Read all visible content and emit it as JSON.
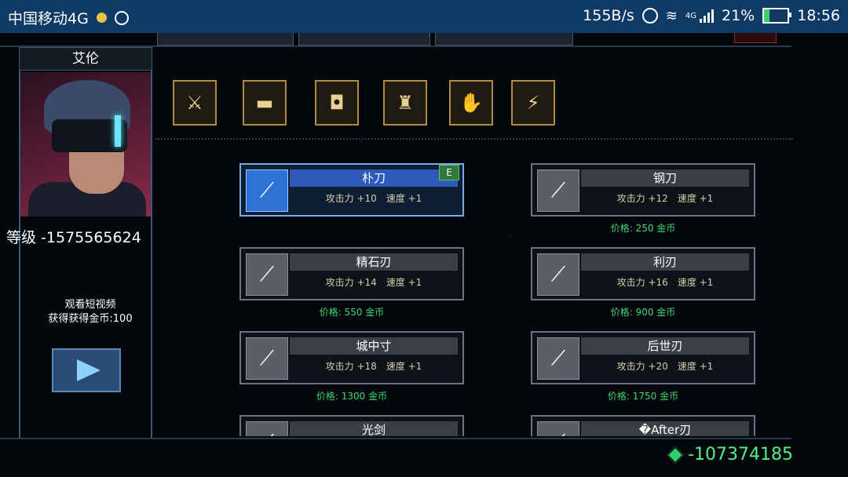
{
  "status_bar": {
    "carrier": "中国移动4G",
    "net_speed": "155B/s",
    "network_type": "4G",
    "battery": "21%",
    "battery_level": 0.21,
    "time": "18:56"
  },
  "character": {
    "name": "艾伦",
    "level_line": "等级 -1575565624"
  },
  "video_reward": {
    "line1": "观看短视频",
    "line2": "获得获得金币:100"
  },
  "categories": [
    {
      "icon": "blade-icon"
    },
    {
      "icon": "gun-icon"
    },
    {
      "icon": "helmet-icon"
    },
    {
      "icon": "armor-icon"
    },
    {
      "icon": "claw-icon"
    },
    {
      "icon": "energy-icon"
    }
  ],
  "items": [
    {
      "name": "朴刀",
      "attack": "攻击力 +10",
      "speed": "速度 +1",
      "equipped_badge": "E",
      "price": ""
    },
    {
      "name": "钢刀",
      "attack": "攻击力 +12",
      "speed": "速度 +1",
      "price": "价格: 250 金币"
    },
    {
      "name": "精石刃",
      "attack": "攻击力 +14",
      "speed": "速度 +1",
      "price": "价格: 550 金币"
    },
    {
      "name": "利刃",
      "attack": "攻击力 +16",
      "speed": "速度 +1",
      "price": "价格: 900 金币"
    },
    {
      "name": "城中寸",
      "attack": "攻击力 +18",
      "speed": "速度 +1",
      "price": "价格: 1300 金币"
    },
    {
      "name": "后世刃",
      "attack": "攻击力 +20",
      "speed": "速度 +1",
      "price": "价格: 1750 金币"
    },
    {
      "name": "光剑"
    },
    {
      "name": "�After刃"
    }
  ],
  "currency": {
    "value": "-107374185"
  },
  "colors": {
    "status_bar": "#0f3a66",
    "selected_border": "#7aa8e6",
    "price_green": "#3fd56e",
    "gold_border": "#b28a44"
  }
}
